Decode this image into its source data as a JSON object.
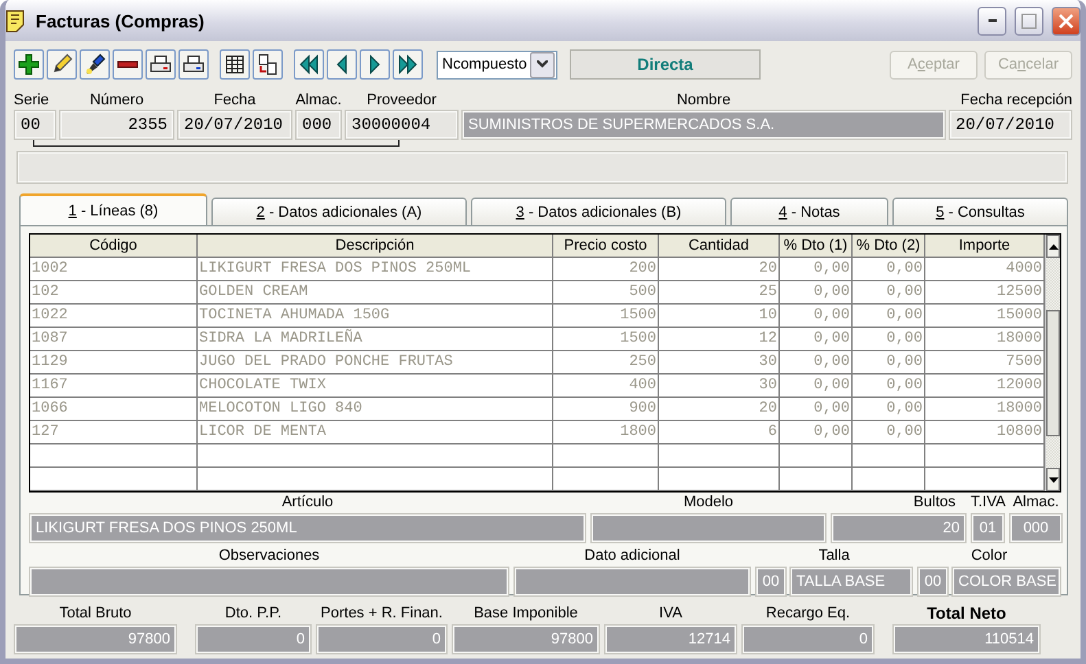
{
  "window": {
    "title": "Facturas (Compras)"
  },
  "toolbar": {
    "dropdown": {
      "value": "Ncompuesto"
    },
    "mode": "Directa",
    "buttons": [
      {
        "before": "A",
        "mnemonic": "c",
        "after": "eptar",
        "disabled": true
      },
      {
        "before": "Ca",
        "mnemonic": "n",
        "after": "celar",
        "disabled": true
      }
    ]
  },
  "header": {
    "fields": [
      {
        "label": "Serie",
        "value": "00",
        "disabled": false
      },
      {
        "label": "Número",
        "value": "2355",
        "disabled": false
      },
      {
        "label": "Fecha",
        "value": "20/07/2010",
        "disabled": false
      },
      {
        "label": "Almac.",
        "value": "000",
        "disabled": false
      },
      {
        "label": "Proveedor",
        "value": "30000004",
        "disabled": false
      },
      {
        "label": "Nombre",
        "value": "SUMINISTROS DE SUPERMERCADOS S.A.",
        "disabled": true
      },
      {
        "label": "Fecha recepción",
        "value": "20/07/2010",
        "disabled": false
      }
    ]
  },
  "tabs": [
    {
      "mnemonic": "1",
      "after": " - Líneas (8)",
      "selected": true
    },
    {
      "mnemonic": "2",
      "after": " - Datos adicionales (A)",
      "selected": false
    },
    {
      "mnemonic": "3",
      "after": " - Datos adicionales (B)",
      "selected": false
    },
    {
      "mnemonic": "4",
      "after": " - Notas",
      "selected": false
    },
    {
      "mnemonic": "5",
      "after": " - Consultas",
      "selected": false
    }
  ],
  "table": {
    "columns": [
      {
        "label": "Código",
        "kind": "text"
      },
      {
        "label": "Descripción",
        "kind": "text"
      },
      {
        "label": "Precio costo",
        "kind": "number"
      },
      {
        "label": "Cantidad",
        "kind": "number"
      },
      {
        "label": "% Dto (1)",
        "kind": "number"
      },
      {
        "label": "% Dto (2)",
        "kind": "number"
      },
      {
        "label": "Importe",
        "kind": "number"
      }
    ],
    "rows": [
      [
        "1002",
        "LIKIGURT FRESA DOS PINOS 250ML",
        "200",
        "20",
        "0,00",
        "0,00",
        "4000"
      ],
      [
        "102",
        "GOLDEN CREAM",
        "500",
        "25",
        "0,00",
        "0,00",
        "12500"
      ],
      [
        "1022",
        "TOCINETA AHUMADA 150G",
        "1500",
        "10",
        "0,00",
        "0,00",
        "15000"
      ],
      [
        "1087",
        "SIDRA LA MADRILEÑA",
        "1500",
        "12",
        "0,00",
        "0,00",
        "18000"
      ],
      [
        "1129",
        "JUGO DEL PRADO PONCHE FRUTAS",
        "250",
        "30",
        "0,00",
        "0,00",
        "7500"
      ],
      [
        "1167",
        "CHOCOLATE TWIX",
        "400",
        "30",
        "0,00",
        "0,00",
        "12000"
      ],
      [
        "1066",
        "MELOCOTON LIGO 840",
        "900",
        "20",
        "0,00",
        "0,00",
        "18000"
      ],
      [
        "127",
        "LICOR DE MENTA",
        "1800",
        "6",
        "0,00",
        "0,00",
        "10800"
      ]
    ]
  },
  "article": {
    "fields": [
      {
        "label": "Artículo",
        "value": "LIKIGURT FRESA DOS PINOS 250ML",
        "kind": "text"
      },
      {
        "label": "Modelo",
        "kind": "text"
      },
      {
        "label": "Bultos",
        "value": "20",
        "kind": "number"
      },
      {
        "label": "T.IVA",
        "value": "01",
        "kind": "code"
      },
      {
        "label": "Almac.",
        "value": "000",
        "kind": "code"
      }
    ]
  },
  "details": {
    "fields": [
      {
        "label": "Observaciones"
      },
      {
        "label": "Dato adicional"
      },
      {
        "label": "Talla",
        "code": "00",
        "value": "TALLA BASE"
      },
      {
        "label": "Color",
        "code": "00",
        "value": "COLOR BASE"
      }
    ]
  },
  "totals": [
    {
      "label": "Total Bruto",
      "value": "97800",
      "emphasis": false
    },
    {
      "label": "Dto. P.P.",
      "value": "0",
      "emphasis": false
    },
    {
      "label": "Portes + R. Finan.",
      "value": "0",
      "emphasis": false
    },
    {
      "label": "Base Imponible",
      "value": "97800",
      "emphasis": false
    },
    {
      "label": "IVA",
      "value": "12714",
      "emphasis": false
    },
    {
      "label": "Recargo Eq.",
      "value": "0",
      "emphasis": false
    },
    {
      "label": "Total Neto",
      "value": "110514",
      "emphasis": true
    }
  ]
}
